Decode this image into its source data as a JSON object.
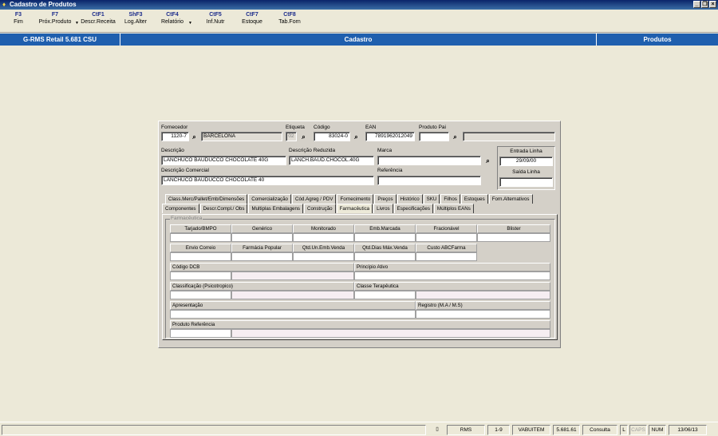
{
  "window": {
    "title": "Cadastro de Produtos"
  },
  "toolbar": [
    {
      "key": "F3",
      "label": "Fim"
    },
    {
      "key": "F7",
      "label": "Próx.Produto"
    },
    {
      "key": "CtF1",
      "label": "Descr.Receita"
    },
    {
      "key": "ShF3",
      "label": "Log.Alter"
    },
    {
      "key": "CtF4",
      "label": "Relatório"
    },
    {
      "key": "CtF5",
      "label": "Inf.Nutr"
    },
    {
      "key": "CtF7",
      "label": "Estoque"
    },
    {
      "key": "CtF8",
      "label": "Tab.Forn"
    }
  ],
  "header": {
    "app": "G-RMS Retail 5.681 CSU",
    "center": "Cadastro",
    "right": "Produtos"
  },
  "form": {
    "fornecedor": {
      "label": "Fornecedor",
      "code": "1120-7",
      "name": "BARCELONA"
    },
    "etiqueta": {
      "label": "Etiqueta",
      "value": "02"
    },
    "codigo": {
      "label": "Código",
      "value": "83024-0"
    },
    "ean": {
      "label": "EAN",
      "value": "7891962012049"
    },
    "produto_pai": {
      "label": "Produto Pai",
      "value": ""
    },
    "descricao": {
      "label": "Descrição",
      "value": "LANCHUCO BAUDUCCO CHOCOLATE 40G"
    },
    "descricao_reduzida": {
      "label": "Descrição Reduzida",
      "value": "LANCH.BAUD.CHOCOL.40G"
    },
    "marca": {
      "label": "Marca",
      "value": ""
    },
    "descricao_comercial": {
      "label": "Descrição Comercial",
      "value": "LANCHUCO BAUDUCCO CHOCOLATE 40"
    },
    "referencia": {
      "label": "Referência",
      "value": ""
    },
    "entrada_linha": {
      "label": "Entrada Linha",
      "value": "29/09/00"
    },
    "saida_linha": {
      "label": "Saída Linha",
      "value": ""
    }
  },
  "tabs_row1": [
    "Class.Merc/Pallet/Emb/Dimensões",
    "Comercialização",
    "Cód.Agreg / PDV",
    "Fornecimento",
    "Preços",
    "Histórico",
    "SKU",
    "Filhos",
    "Estoques",
    "Forn.Alternativos"
  ],
  "tabs_row2": [
    "Componentes",
    "Descr.Compl./ Obs",
    "Multiplas Embalagens",
    "Construção",
    "Farmacêutica",
    "Livros",
    "Especificações",
    "Múltiplos EANs"
  ],
  "active_tab": "Farmacêutica",
  "farmaceutica": {
    "group_title": "Farmacêutica",
    "row1": [
      "Tarjado/BMPO",
      "Genérico",
      "Monitorado",
      "Emb.Marcada",
      "Fracionável",
      "Blister"
    ],
    "row2": [
      "Envio Correio",
      "Farmácia Popular",
      "Qtd.Un.Emb.Venda",
      "Qtd.Dias Máx.Venda",
      "Custo ABCFarma"
    ],
    "codigo_dcb": "Código DCB",
    "principio_ativo": "Princípio Ativo",
    "classificacao": "Classificação (Psicotropico)",
    "classe_terapeutica": "Classe Terapêutica",
    "apresentacao": "Apresentação",
    "registro": "Registro (M.A / M.S)",
    "produto_referencia": "Produto Referência"
  },
  "status": {
    "rms": "RMS",
    "page": "1-9",
    "user": "VABUITEM",
    "version": "5.681.61",
    "mode": "Consulta",
    "l": "L",
    "caps": "CAPS",
    "num": "NUM",
    "date": "13/06/13"
  }
}
